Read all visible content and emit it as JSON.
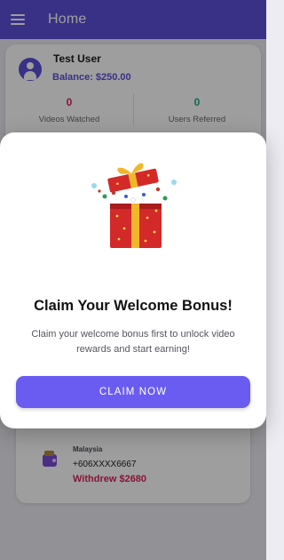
{
  "appbar": {
    "title": "Home",
    "menu_icon": "menu-icon"
  },
  "user": {
    "name": "Test User",
    "balance": "Balance: $250.00",
    "avatar_icon": "account-circle-icon"
  },
  "stats": [
    {
      "value": "0",
      "label": "Videos Watched",
      "color": "#d9235a"
    },
    {
      "value": "0",
      "label": "Users Referred",
      "color": "#1ea58b"
    }
  ],
  "withdrawal": {
    "icon": "wallet-icon",
    "country": "Malaysia",
    "phone": "+606XXXX6667",
    "amount": "Withdrew $2680",
    "amount_color": "#d9235a"
  },
  "modal": {
    "illustration": "gift-box-icon",
    "title": "Claim Your Welcome Bonus!",
    "description": "Claim your welcome bonus first to unlock video rewards and start earning!",
    "button_label": "CLAIM NOW"
  },
  "colors": {
    "primary": "#5b4fd8",
    "button": "#6a5cf0",
    "accent_red": "#d9235a",
    "accent_green": "#1ea58b"
  }
}
